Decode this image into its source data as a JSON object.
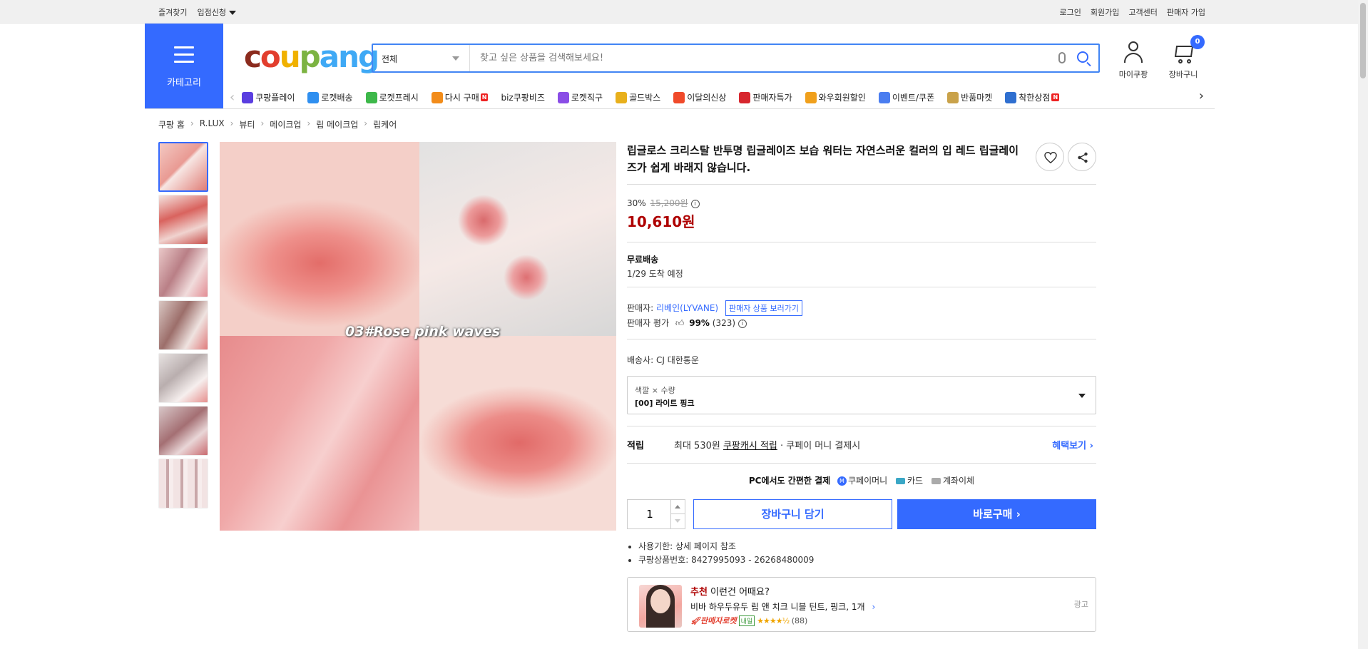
{
  "topbar": {
    "left": [
      "즐겨찾기",
      "입점신청"
    ],
    "right": [
      "로그인",
      "회원가입",
      "고객센터",
      "판매자 가입"
    ]
  },
  "header": {
    "category_label": "카테고리",
    "logo_parts": [
      "c",
      "o",
      "u",
      "p",
      "ang"
    ],
    "search_category": "전체",
    "search_placeholder": "찾고 싶은 상품을 검색해보세요!",
    "mycoupang_label": "마이쿠팡",
    "cart_label": "장바구니",
    "cart_count": "0"
  },
  "catnav": [
    {
      "label": "쿠팡플레이",
      "color": "#5a3ee0",
      "new": false
    },
    {
      "label": "로켓배송",
      "color": "#2f8ff0",
      "new": false
    },
    {
      "label": "로켓프레시",
      "color": "#3db84a",
      "new": false
    },
    {
      "label": "다시 구매",
      "color": "#f28c1a",
      "new": true
    },
    {
      "label": "biz쿠팡비즈",
      "color": "",
      "new": false
    },
    {
      "label": "로켓직구",
      "color": "#8a4de6",
      "new": false
    },
    {
      "label": "골드박스",
      "color": "#e8b01c",
      "new": false
    },
    {
      "label": "이달의신상",
      "color": "#f04a2a",
      "new": false
    },
    {
      "label": "판매자특가",
      "color": "#d7262e",
      "new": false
    },
    {
      "label": "와우회원할인",
      "color": "#f0a01c",
      "new": false
    },
    {
      "label": "이벤트/쿠폰",
      "color": "#4a7df0",
      "new": false
    },
    {
      "label": "반품마켓",
      "color": "#c9a24a",
      "new": false
    },
    {
      "label": "착한상점",
      "color": "#2f6fd0",
      "new": true
    }
  ],
  "new_badge": "N",
  "breadcrumb": [
    "쿠팡 홈",
    "R.LUX",
    "뷰티",
    "메이크업",
    "립 메이크업",
    "립케어"
  ],
  "main_image_caption": "03#Rose pink waves",
  "product": {
    "title": "립글로스 크리스탈 반투명 립글레이즈 보습 워터는 자연스러운 컬러의 입 레드 립글레이즈가 쉽게 바래지 않습니다.",
    "discount_rate": "30%",
    "original_price": "15,200원",
    "sale_price": "10,610원",
    "shipping_type": "무료배송",
    "arrival": "1/29 도착 예정",
    "seller_label": "판매자:",
    "seller_name": "리베인(LYVANE)",
    "seller_link": "판매자 상품 보러가기",
    "rating_label": "판매자 평가",
    "rating_pct": "99%",
    "rating_count": "(323)",
    "carrier": "배송사:  CJ 대한통운",
    "option_label": "색깔 × 수량",
    "option_value": "[00] 라이트 핑크",
    "reward_title": "적립",
    "reward_prefix": "최대 530원",
    "reward_link": "쿠팡캐시 적립",
    "reward_suffix": " · 쿠페이 머니 결제시",
    "reward_benefit": "혜택보기 ›",
    "pay_title": "PC에서도 간편한 결제",
    "pay_money": "쿠페이머니",
    "pay_card": "카드",
    "pay_bank": "계좌이체",
    "quantity": "1",
    "cart_button": "장바구니 담기",
    "buy_button": "바로구매 ›",
    "notes": [
      "사용기한: 상세 페이지 참조",
      "쿠팡상품번호: 8427995093 - 26268480009"
    ]
  },
  "ad": {
    "title_red": "추천",
    "title_rest": " 이런건 어때요?",
    "product": "비바 하우두유두 립 앤 치크 니블 틴트, 핑크, 1개",
    "rocket": "판매자로켓",
    "tag": "내일",
    "stars": "★★★★½",
    "reviews": "(88)",
    "ad_label": "광고"
  }
}
